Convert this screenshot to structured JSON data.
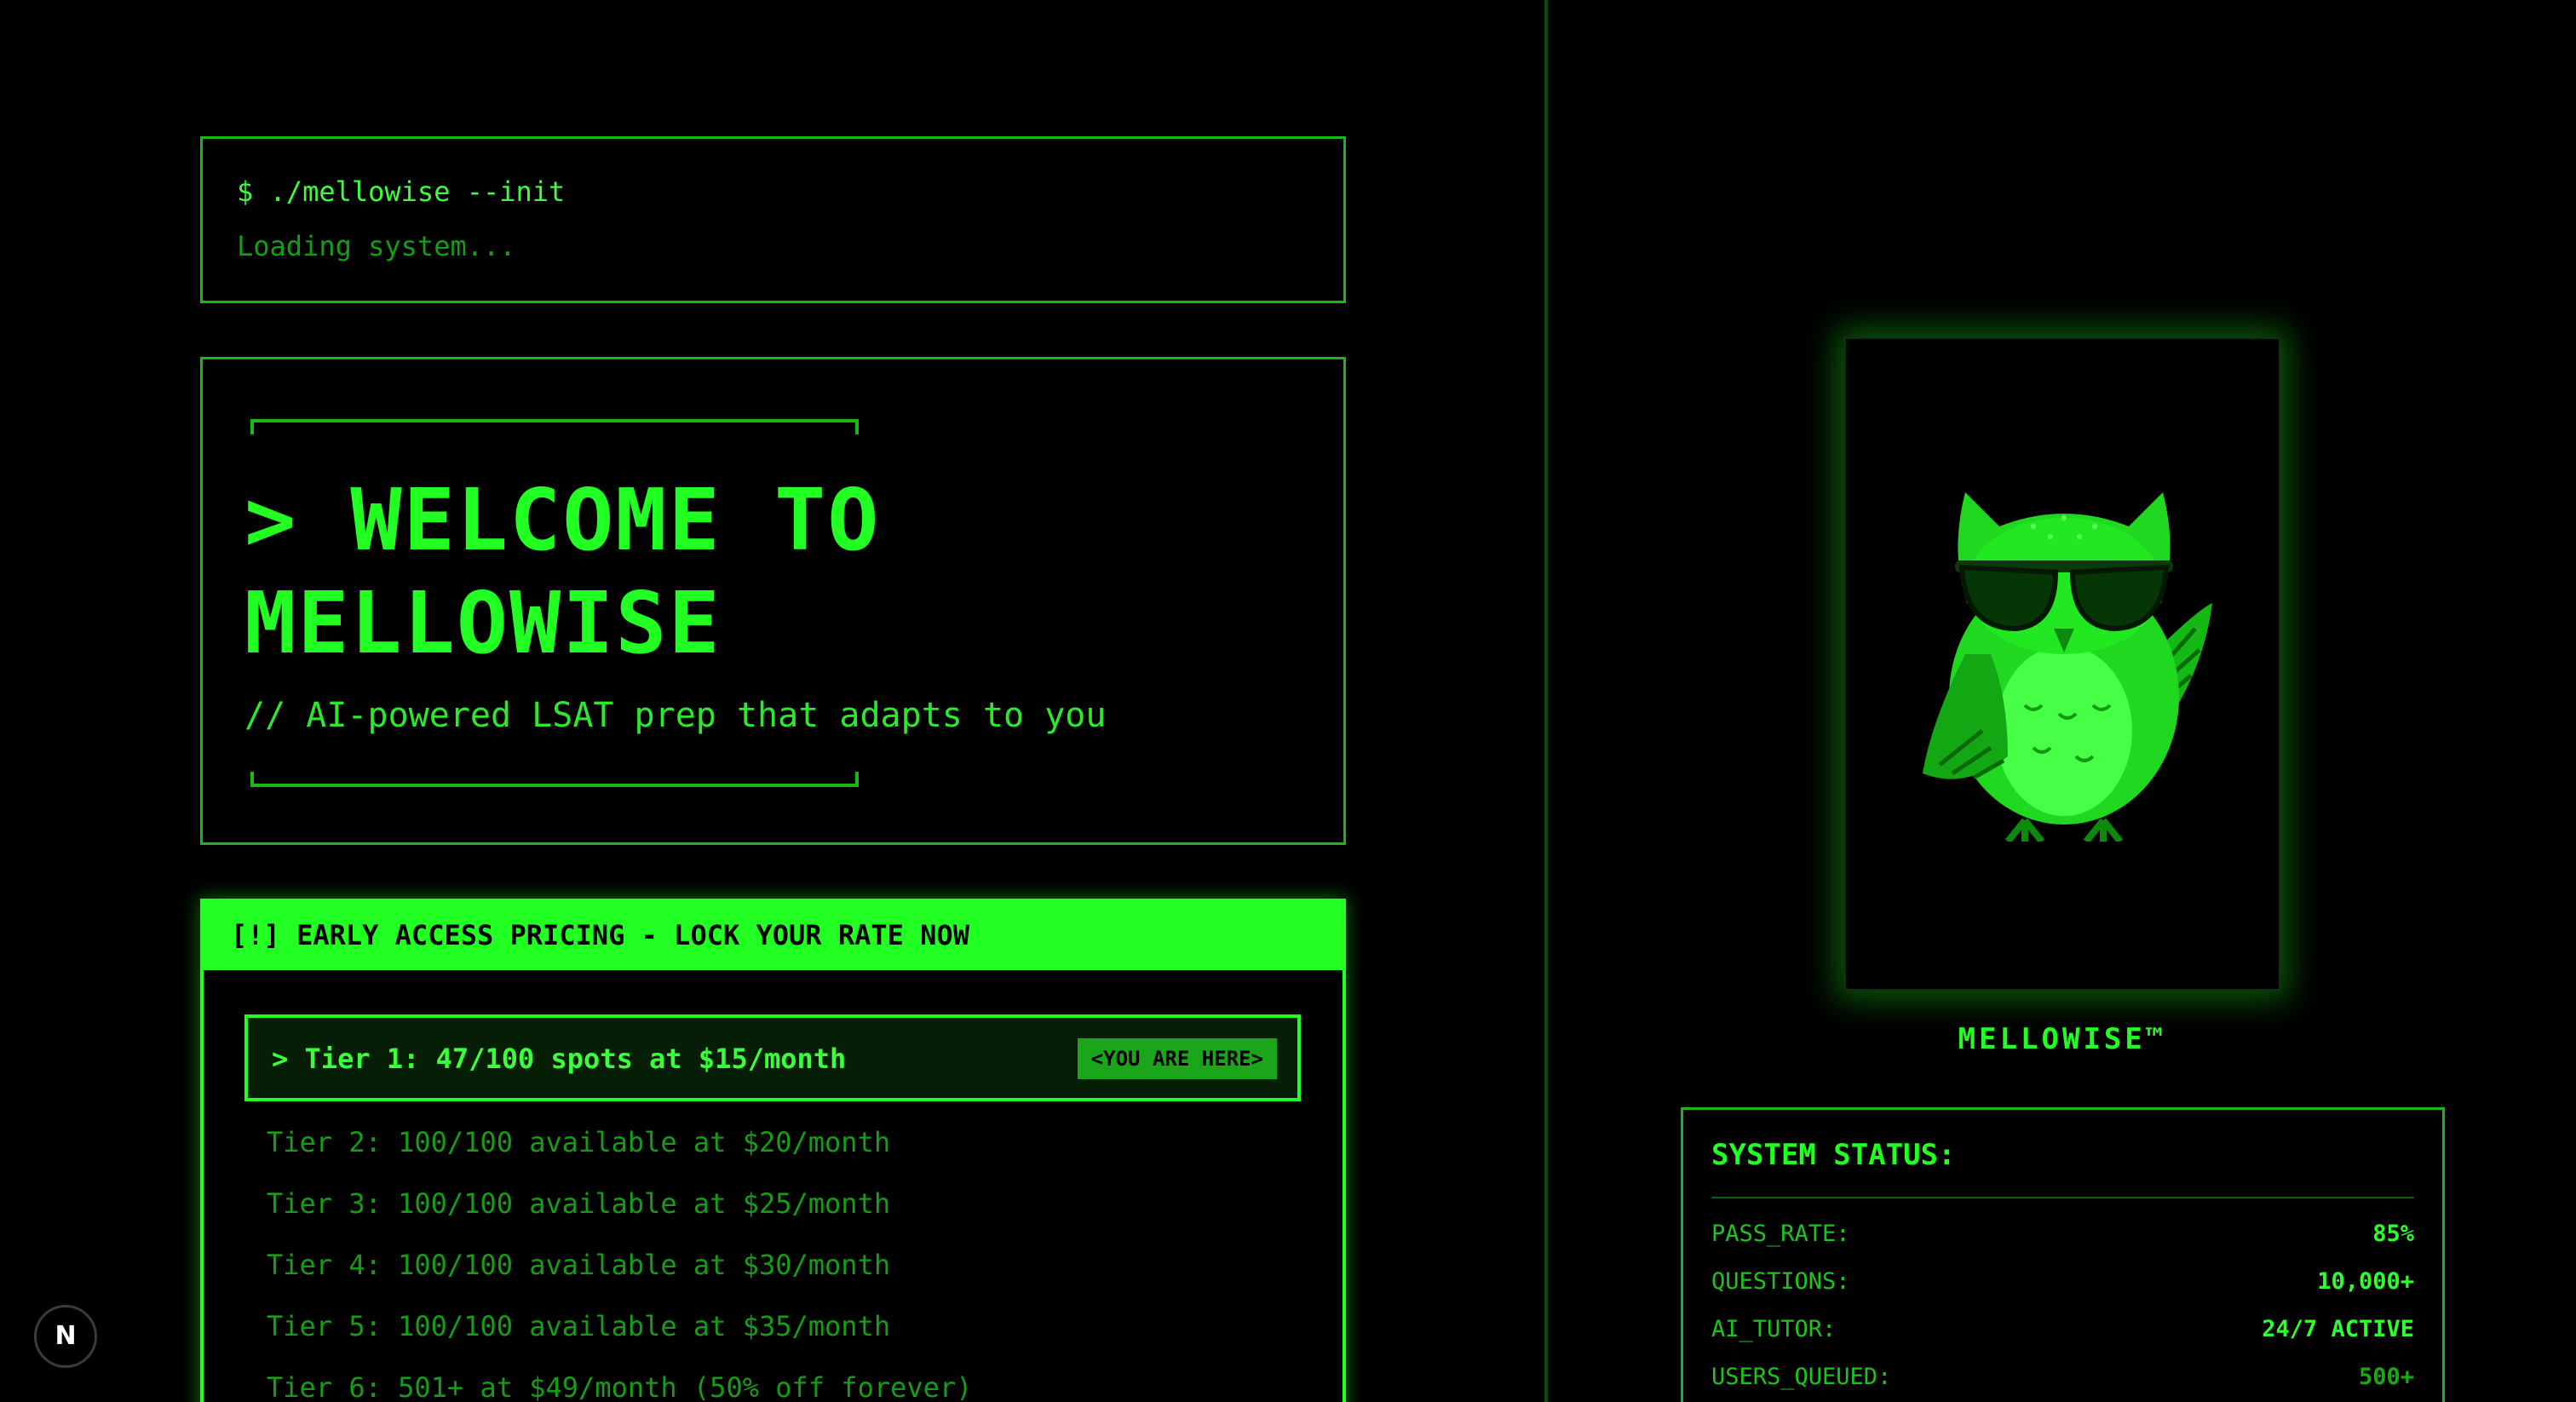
{
  "terminal": {
    "command": "$ ./mellowise --init",
    "status": "Loading system..."
  },
  "welcome": {
    "title": "> WELCOME TO MELLOWISE",
    "subtitle": "// AI-powered LSAT prep that adapts to you"
  },
  "pricing": {
    "header": "[!] EARLY ACCESS PRICING - LOCK YOUR RATE NOW",
    "active_tier": "> Tier 1: 47/100 spots at $15/month",
    "active_badge": "<YOU ARE HERE>",
    "tiers": [
      "Tier 2: 100/100 available at $20/month",
      "Tier 3: 100/100 available at $25/month",
      "Tier 4: 100/100 available at $30/month",
      "Tier 5: 100/100 available at $35/month",
      "Tier 6: 501+ at $49/month (50% off forever)"
    ]
  },
  "brand": {
    "name": "MELLOWISE™"
  },
  "status": {
    "title": "SYSTEM STATUS:",
    "rows": [
      {
        "key": "PASS_RATE:",
        "value": "85%"
      },
      {
        "key": "QUESTIONS:",
        "value": "10,000+"
      },
      {
        "key": "AI_TUTOR:",
        "value": "24/7 ACTIVE"
      },
      {
        "key": "USERS_QUEUED:",
        "value": "500+"
      }
    ]
  },
  "dev_badge": {
    "letter": "N"
  },
  "colors": {
    "background": "#000000",
    "accent": "#22ff22",
    "dim": "#159e15"
  },
  "icons": {
    "mascot": "owl-with-sunglasses",
    "dev_indicator": "nextjs-logo-icon"
  }
}
